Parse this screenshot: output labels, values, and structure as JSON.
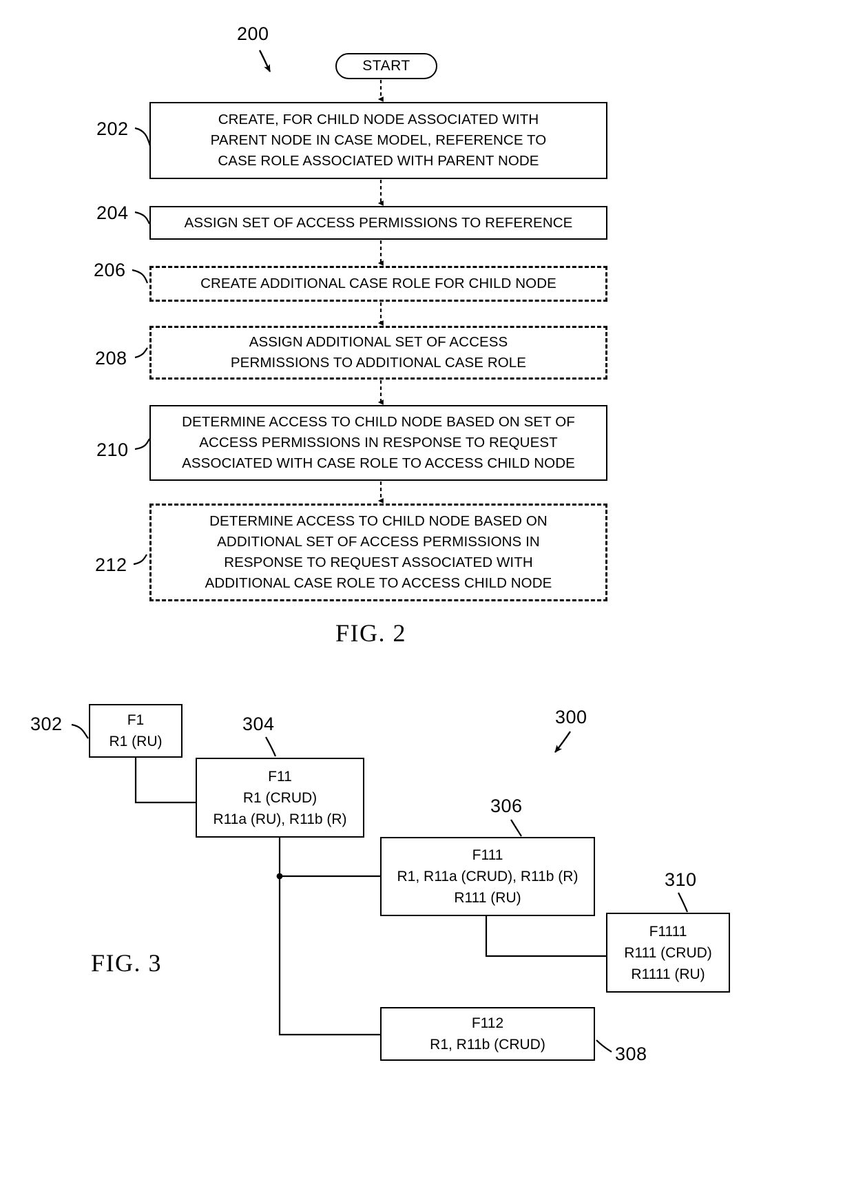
{
  "figure2": {
    "label": "FIG. 2",
    "diagram_ref": "200",
    "start": {
      "label": "START"
    },
    "steps": [
      {
        "ref": "202",
        "text": "CREATE, FOR CHILD NODE ASSOCIATED WITH\nPARENT NODE IN CASE MODEL, REFERENCE TO\nCASE ROLE ASSOCIATED WITH PARENT NODE",
        "style": "solid"
      },
      {
        "ref": "204",
        "text": "ASSIGN SET OF ACCESS PERMISSIONS TO REFERENCE",
        "style": "solid"
      },
      {
        "ref": "206",
        "text": "CREATE ADDITIONAL CASE ROLE FOR CHILD NODE",
        "style": "dashed"
      },
      {
        "ref": "208",
        "text": "ASSIGN ADDITIONAL SET OF ACCESS\nPERMISSIONS TO ADDITIONAL CASE ROLE",
        "style": "dashed"
      },
      {
        "ref": "210",
        "text": "DETERMINE ACCESS TO CHILD NODE BASED ON SET OF\nACCESS PERMISSIONS IN RESPONSE TO REQUEST\nASSOCIATED WITH CASE ROLE TO ACCESS CHILD NODE",
        "style": "solid"
      },
      {
        "ref": "212",
        "text": "DETERMINE ACCESS TO CHILD NODE BASED ON\nADDITIONAL SET OF ACCESS PERMISSIONS IN\nRESPONSE TO REQUEST ASSOCIATED WITH\nADDITIONAL CASE ROLE TO ACCESS CHILD NODE",
        "style": "dashed"
      }
    ]
  },
  "figure3": {
    "label": "FIG. 3",
    "diagram_ref": "300",
    "nodes": [
      {
        "ref": "302",
        "lines": [
          "F1",
          "R1 (RU)"
        ]
      },
      {
        "ref": "304",
        "lines": [
          "F11",
          "R1 (CRUD)",
          "R11a (RU), R11b (R)"
        ]
      },
      {
        "ref": "306",
        "lines": [
          "F111",
          "R1, R11a (CRUD), R11b (R)",
          "R111 (RU)"
        ]
      },
      {
        "ref": "310",
        "lines": [
          "F1111",
          "R111 (CRUD)",
          "R1111 (RU)"
        ]
      },
      {
        "ref": "308",
        "lines": [
          "F112",
          "R1, R11b (CRUD)"
        ]
      }
    ]
  }
}
